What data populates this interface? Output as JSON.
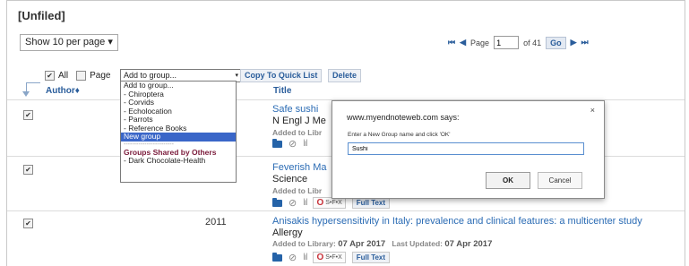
{
  "page_title": "[Unfiled]",
  "per_page": "Show 10 per page",
  "per_page_chevron": "▾",
  "pager": {
    "first": "⏮",
    "prev": "◀",
    "page_label": "Page",
    "page_value": "1",
    "of_label": "of 41",
    "go_label": "Go",
    "next": "▶",
    "last": "⏭"
  },
  "selection": {
    "all_label": "All",
    "page_label": "Page",
    "check": "✔"
  },
  "group_select": {
    "value": "Add to group...",
    "chevron": "▾",
    "options": [
      "Add to group...",
      "- Chiroptera",
      "- Corvids",
      "- Echolocation",
      "- Parrots",
      "- Reference Books",
      "New group"
    ],
    "selected_option": "New group",
    "separator": "------------------------",
    "shared_header": "Groups Shared by Others",
    "shared_options": [
      "- Dark Chocolate-Health"
    ]
  },
  "toolbar": {
    "copy_label": "Copy To Quick List",
    "delete_label": "Delete"
  },
  "columns": {
    "author": "Author",
    "author_sort": "♦",
    "title": "Title"
  },
  "references": [
    {
      "year": "",
      "title": "Safe sushi",
      "journal": "N Engl J Me",
      "added_label": "Added to Libr",
      "added_date": "",
      "updated_label": "",
      "updated_date": ""
    },
    {
      "year": "",
      "title": "Feverish Ma",
      "journal": "Science",
      "added_label": "Added to Libr",
      "added_date": "",
      "updated_label": "",
      "updated_date": ""
    },
    {
      "year": "2011",
      "title": "Anisakis hypersensitivity in Italy: prevalence and clinical features: a multicenter study",
      "journal": "Allergy",
      "added_label": "Added to Library:",
      "added_date": "07 Apr 2017",
      "updated_label": "Last Updated:",
      "updated_date": "07 Apr 2017"
    }
  ],
  "link_buttons": {
    "sfx_o": "O",
    "sfx_label": "S•F•X",
    "fulltext": "Full Text"
  },
  "icons": {
    "clip": "⊘",
    "bars": "lıl"
  },
  "dialog": {
    "title": "www.myendnoteweb.com says:",
    "close": "×",
    "prompt": "Enter a New Group name and click 'OK'",
    "input_value": "Sushi",
    "ok_label": "OK",
    "cancel_label": "Cancel"
  }
}
